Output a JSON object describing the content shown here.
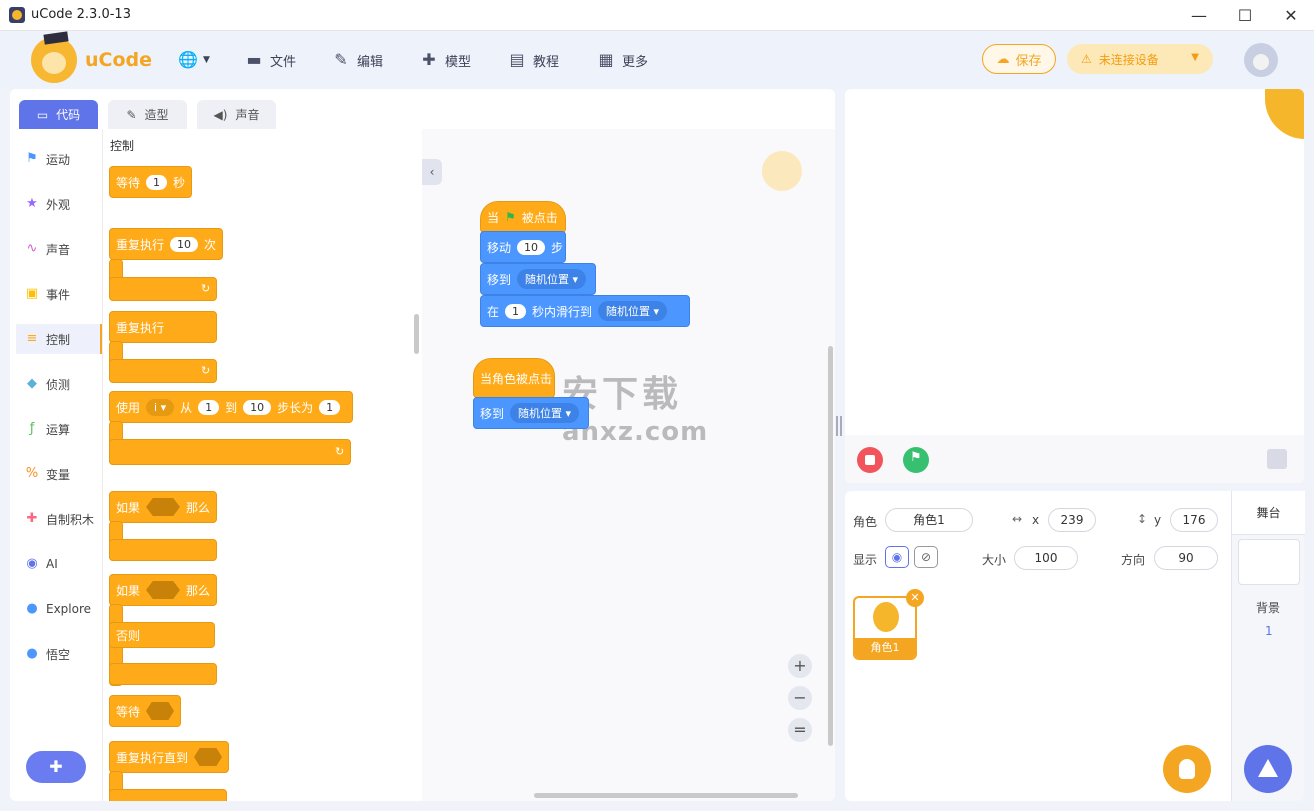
{
  "window": {
    "title": "uCode 2.3.0-13"
  },
  "header": {
    "logo_text": "uCode",
    "menu": [
      {
        "label": "文件",
        "icon": "folder-icon"
      },
      {
        "label": "编辑",
        "icon": "pen-icon"
      },
      {
        "label": "模型",
        "icon": "puzzle-icon"
      },
      {
        "label": "教程",
        "icon": "book-icon"
      },
      {
        "label": "更多",
        "icon": "grid-icon"
      }
    ],
    "save_label": "保存",
    "device_label": "未连接设备"
  },
  "tabs": [
    {
      "label": "代码",
      "icon": "code-icon"
    },
    {
      "label": "造型",
      "icon": "brush-icon"
    },
    {
      "label": "声音",
      "icon": "speaker-icon"
    }
  ],
  "categories": [
    {
      "label": "运动",
      "color": "#4c97ff"
    },
    {
      "label": "外观",
      "color": "#9966ff"
    },
    {
      "label": "声音",
      "color": "#cf63cf"
    },
    {
      "label": "事件",
      "color": "#ffbf00"
    },
    {
      "label": "控制",
      "color": "#ffab19"
    },
    {
      "label": "侦测",
      "color": "#5cb1d6"
    },
    {
      "label": "运算",
      "color": "#59c059"
    },
    {
      "label": "变量",
      "color": "#ff8c1a"
    },
    {
      "label": "自制积木",
      "color": "#ff6680"
    },
    {
      "label": "AI",
      "color": "#5f74e8"
    },
    {
      "label": "Explore",
      "color": "#4c97ff"
    },
    {
      "label": "悟空",
      "color": "#4c97ff"
    }
  ],
  "palette": {
    "title": "控制",
    "wait": {
      "a": "等待",
      "val": "1",
      "b": "秒"
    },
    "repeat": {
      "a": "重复执行",
      "val": "10",
      "b": "次"
    },
    "forever": "重复执行",
    "for_loop": {
      "a": "使用",
      "var": "i",
      "b": "从",
      "v1": "1",
      "c": "到",
      "v2": "10",
      "d": "步长为",
      "v3": "1"
    },
    "if_then": {
      "a": "如果",
      "b": "那么"
    },
    "if_else": {
      "a": "如果",
      "b": "那么",
      "else": "否则"
    },
    "wait_until": "等待",
    "repeat_until": "重复执行直到"
  },
  "workspace": {
    "script1": {
      "hat": {
        "a": "当",
        "b": "被点击"
      },
      "move": {
        "a": "移动",
        "val": "10",
        "b": "步"
      },
      "goto": {
        "a": "移到",
        "drop": "随机位置"
      },
      "glide": {
        "a": "在",
        "val": "1",
        "b": "秒内滑行到",
        "drop": "随机位置"
      }
    },
    "script2": {
      "hat": "当角色被点击",
      "goto": {
        "a": "移到",
        "drop": "随机位置"
      }
    },
    "watermark_main": "安下载",
    "watermark_sub": "anxz.com"
  },
  "sprite": {
    "role_label": "角色",
    "name": "角色1",
    "x_label": "x",
    "x": "239",
    "y_label": "y",
    "y": "176",
    "show_label": "显示",
    "size_label": "大小",
    "size": "100",
    "direction_label": "方向",
    "direction": "90",
    "card_name": "角色1"
  },
  "stage_panel": {
    "title": "舞台",
    "backdrop_label": "背景",
    "backdrop_count": "1"
  }
}
